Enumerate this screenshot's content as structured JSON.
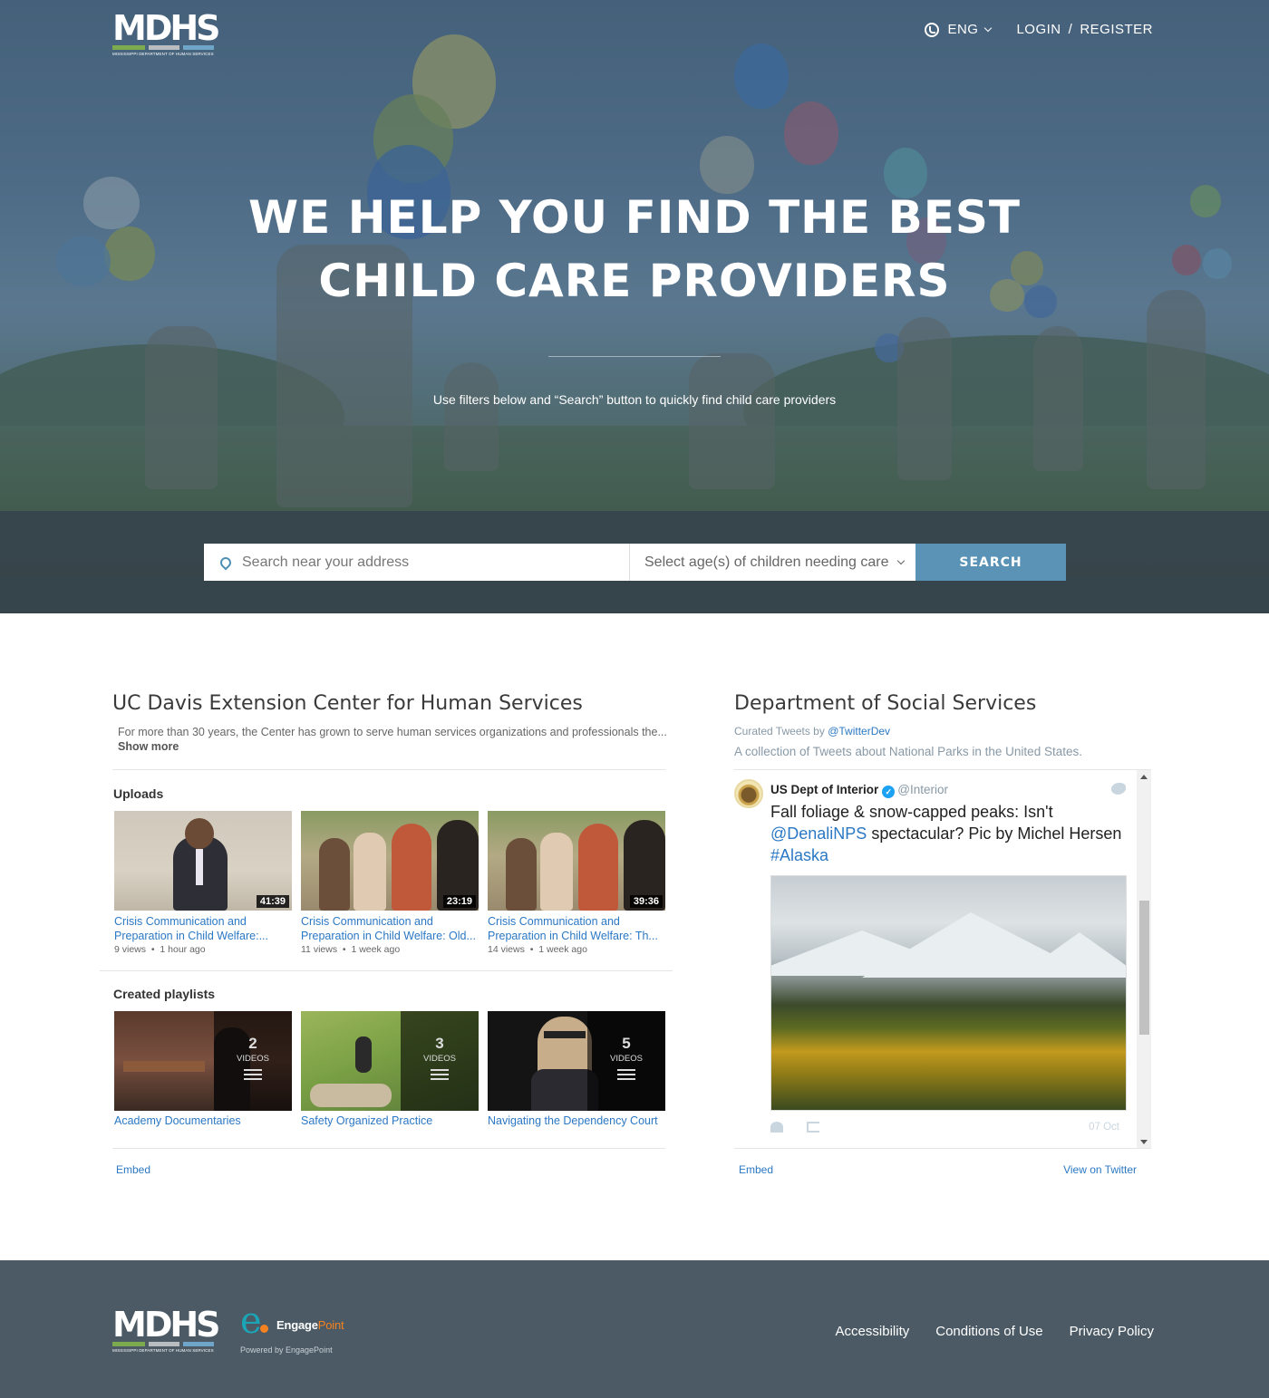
{
  "header": {
    "logo_text": "MDHS",
    "logo_subtitle": "MISSISSIPPI DEPARTMENT OF HUMAN SERVICES",
    "language": "ENG",
    "login": "LOGIN",
    "separator": "/",
    "register": "REGISTER"
  },
  "hero": {
    "title_line1": "WE HELP YOU FIND THE BEST",
    "title_line2": "CHILD CARE PROVIDERS",
    "subtitle": "Use filters below and “Search” button to quickly find child care providers"
  },
  "search": {
    "address_placeholder": "Search near your address",
    "ages_label": "Select age(s) of children needing care",
    "button": "SEARCH"
  },
  "youtube_card": {
    "title": "UC Davis Extension Center for Human Services",
    "description": "For more than 30 years, the Center has grown to serve human services organizations and professionals the...",
    "show_more": "Show more",
    "uploads_label": "Uploads",
    "uploads": [
      {
        "title_line1": "Crisis Communication and",
        "title_line2": "Preparation in Child Welfare:...",
        "duration": "41:39",
        "views": "9 views",
        "age": "1 hour ago"
      },
      {
        "title_line1": "Crisis Communication and",
        "title_line2": "Preparation in Child Welfare: Old...",
        "duration": "23:19",
        "views": "11 views",
        "age": "1 week ago"
      },
      {
        "title_line1": "Crisis Communication and",
        "title_line2": "Preparation in Child Welfare: Th...",
        "duration": "39:36",
        "views": "14 views",
        "age": "1 week ago"
      }
    ],
    "playlists_label": "Created playlists",
    "playlists": [
      {
        "title": "Academy Documentaries",
        "count": "2",
        "unit": "VIDEOS"
      },
      {
        "title": "Safety Organized Practice",
        "count": "3",
        "unit": "VIDEOS"
      },
      {
        "title": "Navigating the Dependency Court",
        "count": "5",
        "unit": "VIDEOS"
      }
    ],
    "meta_separator": "•",
    "embed": "Embed"
  },
  "twitter_card": {
    "title": "Department of Social Services",
    "curated_prefix": "Curated Tweets by",
    "curator": "@TwitterDev",
    "description": "A collection of Tweets about National Parks in the United States.",
    "tweet": {
      "author": "US Dept of Interior",
      "verified": "✓",
      "handle": "@Interior",
      "text_part1": "Fall foliage & snow-capped peaks: Isn't",
      "mention": "@DenaliNPS",
      "text_part2": "spectacular? Pic by Michel Hersen",
      "hashtag": "#Alaska",
      "date": "07 Oct"
    },
    "embed": "Embed",
    "view_on_twitter": "View on Twitter"
  },
  "footer": {
    "logo_text": "MDHS",
    "logo_subtitle": "MISSISSIPPI DEPARTMENT OF HUMAN SERVICES",
    "partner_mark": "e",
    "partner_name": "Engage",
    "partner_name_accent": "Point",
    "powered_by": "Powered by EngagePoint",
    "links": [
      "Accessibility",
      "Conditions of Use",
      "Privacy Policy"
    ]
  },
  "colors": {
    "accent_blue": "#5a93b5",
    "link_blue": "#2b78c4",
    "footer_bg": "#4b5a65",
    "logo_green": "#7bab4e",
    "logo_gray": "#b9bdc0",
    "logo_blue": "#6fa5c9",
    "engagepoint_orange": "#f58220"
  }
}
